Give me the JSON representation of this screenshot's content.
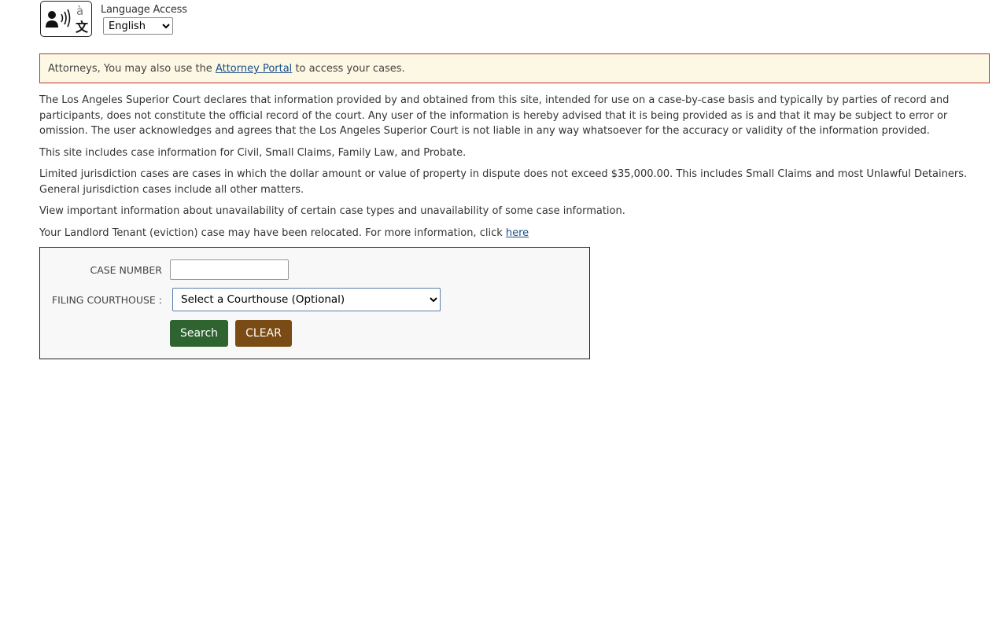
{
  "language": {
    "title": "Language Access",
    "selected": "English",
    "options": [
      "English"
    ],
    "icon": "translate-speech-icon"
  },
  "notice": {
    "prefix": "Attorneys, You may also use the",
    "link_label": "Attorney Portal",
    "suffix": "to access your cases."
  },
  "paragraphs": {
    "disclaimer": "The Los Angeles Superior Court declares that information provided by and obtained from this site, intended for use on a case-by-case basis and typically by parties of record and participants, does not constitute the official record of the court. Any user of the information is hereby advised that it is being provided as is and that it may be subject to error or omission. The user acknowledges and agrees that the Los Angeles Superior Court is not liable in any way whatsoever for the accuracy or validity of the information provided.",
    "case_types": "This site includes case information for Civil, Small Claims, Family Law, and Probate.",
    "jurisdiction": "Limited jurisdiction cases are cases in which the dollar amount or value of property in dispute does not exceed $35,000.00. This includes Small Claims and most Unlawful Detainers. General jurisdiction cases include all other matters.",
    "unavailability": "View important information about unavailability of certain case types and unavailability of some case information.",
    "eviction_prefix": "Your Landlord Tenant (eviction) case may have been relocated. For more information, click",
    "eviction_link": "here"
  },
  "form": {
    "case_number_label": "CASE NUMBER",
    "case_number_value": "",
    "courthouse_label": "FILING COURTHOUSE :",
    "courthouse_selected": "Select a Courthouse (Optional)",
    "search_label": "Search",
    "clear_label": "CLEAR"
  },
  "colors": {
    "notice_border": "#c03030",
    "notice_background": "#fcf8e3",
    "search_button": "#2f6330",
    "clear_button": "#7a4b14",
    "link": "#1a4f8b"
  }
}
